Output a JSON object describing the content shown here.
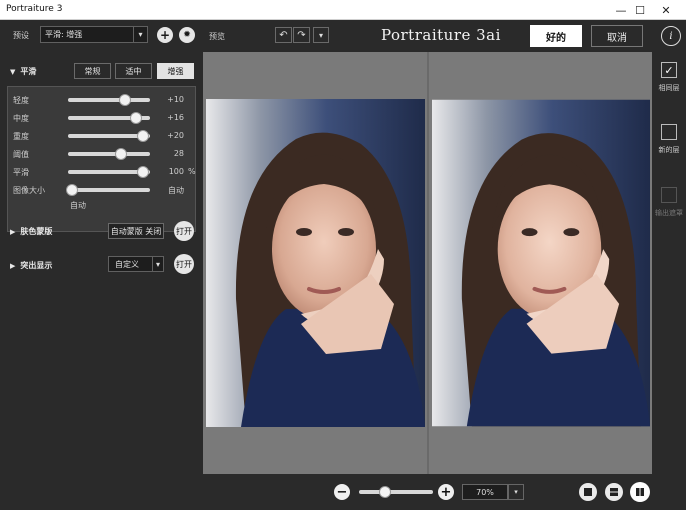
{
  "window": {
    "title": "Portraiture 3"
  },
  "left": {
    "preset_label": "预设",
    "preset_value": "平滑: 增强",
    "smoothing": {
      "title": "平滑",
      "modes": [
        "常规",
        "适中",
        "增强"
      ],
      "active_mode": 2,
      "sliders": [
        {
          "name": "轻度",
          "value": "+10",
          "unit": "",
          "level": 0.7
        },
        {
          "name": "中度",
          "value": "+16",
          "unit": "",
          "level": 0.83
        },
        {
          "name": "重度",
          "value": "+20",
          "unit": "",
          "level": 0.92
        },
        {
          "name": "阈值",
          "value": "28",
          "unit": "",
          "level": 0.65
        },
        {
          "name": "平滑",
          "value": "100",
          "unit": "%",
          "level": 0.92
        },
        {
          "name": "图像大小",
          "value": "自动",
          "unit": "",
          "level": 0.05
        }
      ],
      "image_size_sub": "自动"
    },
    "skin_mask": {
      "title": "肤色蒙版",
      "button": "自动蒙版 关闭",
      "toggle": "打开"
    },
    "enhance": {
      "title": "突出显示",
      "select": "自定义",
      "toggle": "打开"
    }
  },
  "topbar": {
    "preview_label": "预览",
    "brand": "Portraiture 3ai",
    "ok": "好的",
    "cancel": "取消",
    "info": "i"
  },
  "rightbar": {
    "items": [
      {
        "label": "相同层",
        "checked": true
      },
      {
        "label": "新的层",
        "checked": false
      },
      {
        "label": "输出遮罩",
        "checked": false
      }
    ]
  },
  "bottombar": {
    "zoom": "70%",
    "zoom_level": 0.35
  },
  "colors": {
    "panel": "#2a2a2a",
    "canvas": "#7a7a7a",
    "accent": "#ffffff"
  }
}
